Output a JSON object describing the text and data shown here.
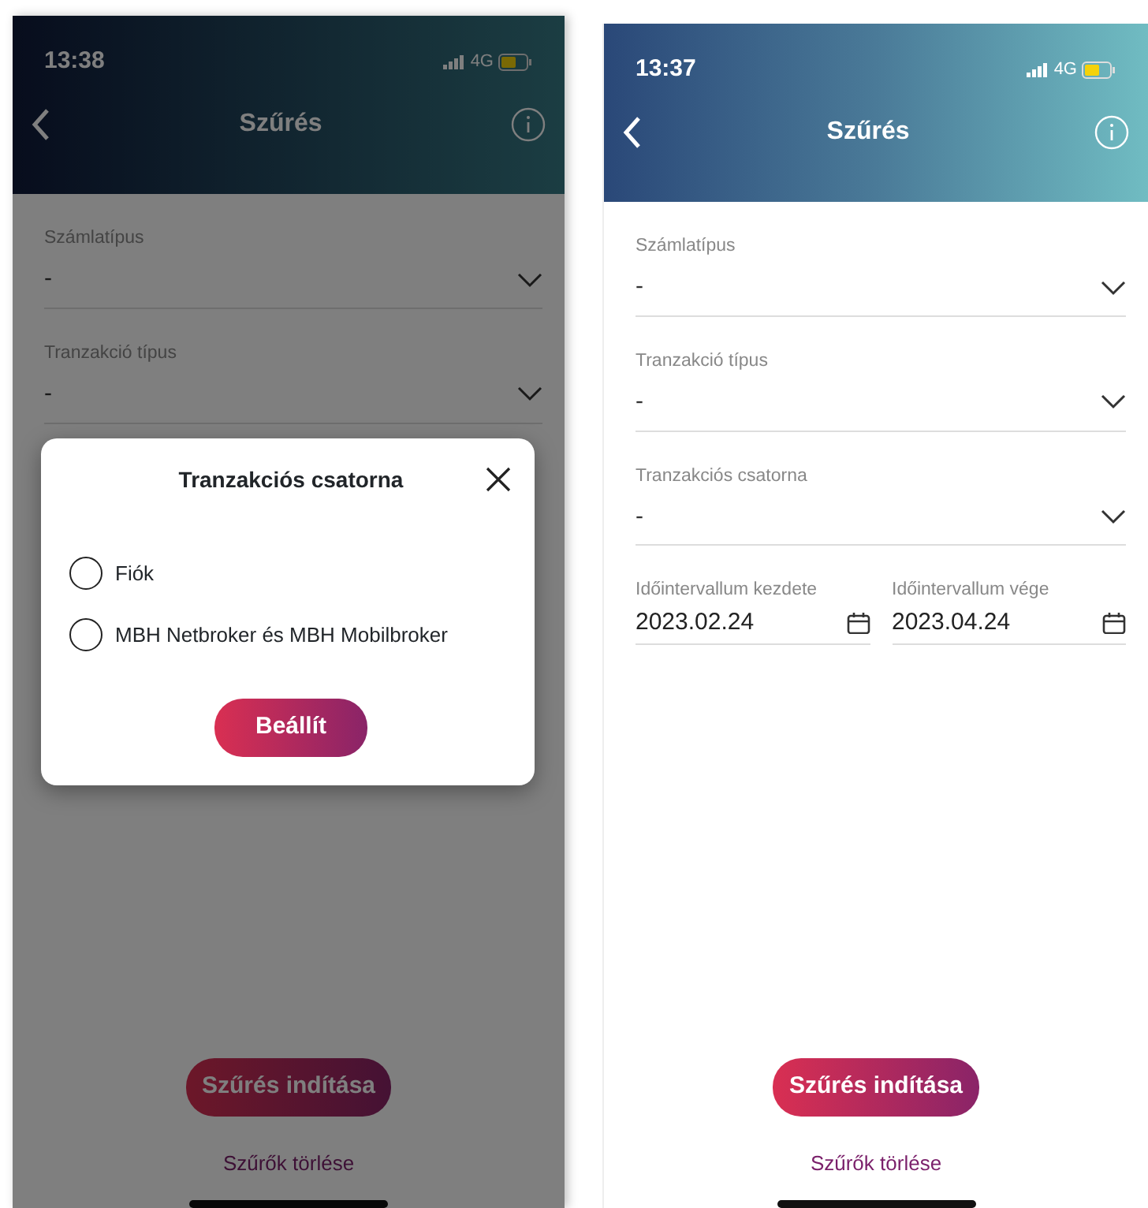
{
  "screens": [
    {
      "status_bar": {
        "time": "13:38",
        "network": "4G"
      },
      "header": {
        "title": "Szűrés"
      },
      "dimmed": true,
      "fields": [
        {
          "kind": "select",
          "label": "Számlatípus",
          "value": "-"
        },
        {
          "kind": "select",
          "label": "Tranzakció típus",
          "value": "-"
        }
      ],
      "dialog": {
        "title": "Tranzakciós csatorna",
        "options": [
          {
            "label": "Fiók",
            "selected": false
          },
          {
            "label": "MBH Netbroker és MBH Mobilbroker",
            "selected": false
          }
        ],
        "button": "Beállít"
      },
      "primary_button": "Szűrés indítása",
      "link": "Szűrők törlése"
    },
    {
      "status_bar": {
        "time": "13:37",
        "network": "4G"
      },
      "header": {
        "title": "Szűrés"
      },
      "fields": [
        {
          "kind": "select",
          "label": "Számlatípus",
          "value": "-"
        },
        {
          "kind": "select",
          "label": "Tranzakció típus",
          "value": "-"
        },
        {
          "kind": "select",
          "label": "Tranzakciós csatorna",
          "value": "-"
        },
        {
          "kind": "date_pair",
          "items": [
            {
              "label": "Időintervallum kezdete",
              "value": "2023.02.24"
            },
            {
              "label": "Időintervallum vége",
              "value": "2023.04.24"
            }
          ]
        }
      ],
      "primary_button": "Szűrés indítása",
      "link": "Szűrők törlése"
    }
  ]
}
